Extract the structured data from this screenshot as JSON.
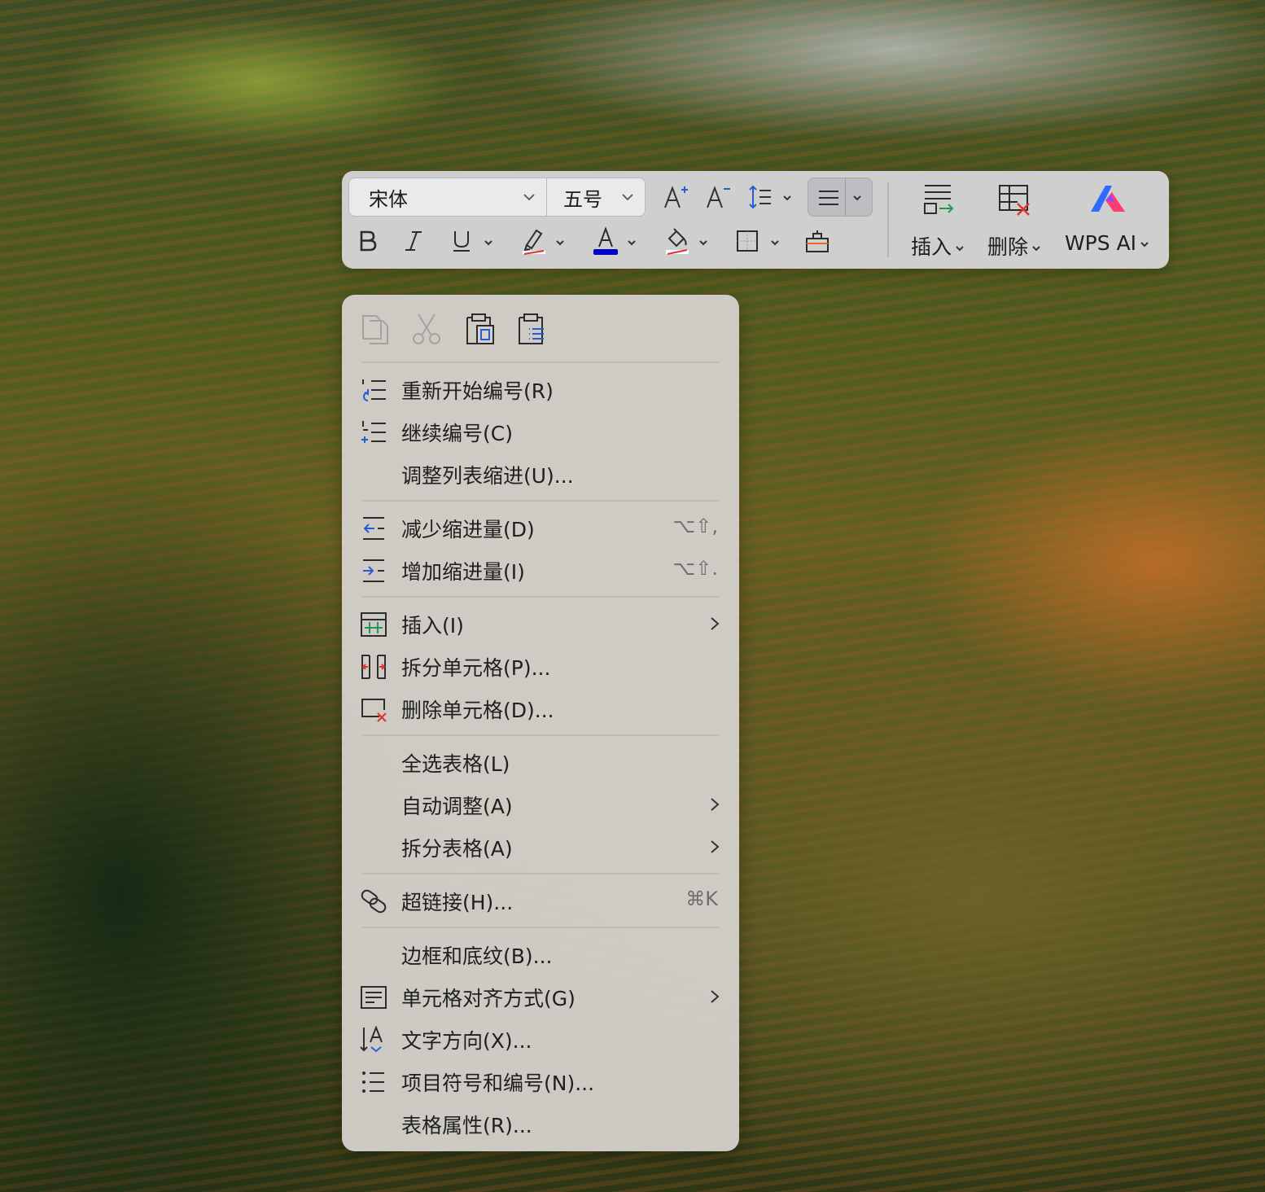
{
  "toolbar": {
    "font_name": "宋体",
    "font_size": "五号",
    "insert_label": "插入",
    "delete_label": "删除",
    "wps_ai_label": "WPS AI",
    "icons": [
      "increase-font-icon",
      "decrease-font-icon",
      "line-spacing-icon",
      "align-icon",
      "bold-icon",
      "italic-icon",
      "underline-icon",
      "highlight-icon",
      "font-color-icon",
      "shading-icon",
      "border-icon",
      "clear-format-icon",
      "insert-icon",
      "delete-table-icon",
      "wps-ai-icon"
    ],
    "font_color": "#0000cc",
    "highlight_color": "#e0332b",
    "wps_ai_colors": [
      "#2f6bff",
      "#ff3d6e"
    ]
  },
  "menu": {
    "clipboard_icons": [
      "copy-icon",
      "cut-icon",
      "paste-icon",
      "paste-special-icon"
    ],
    "items": [
      {
        "label": "重新开始编号(R)",
        "icon": "restart-numbering-icon"
      },
      {
        "label": "继续编号(C)",
        "icon": "continue-numbering-icon"
      },
      {
        "label": "调整列表缩进(U)..."
      },
      {
        "label": "减少缩进量(D)",
        "icon": "decrease-indent-icon",
        "shortcut": "⌥⇧,"
      },
      {
        "label": "增加缩进量(I)",
        "icon": "increase-indent-icon",
        "shortcut": "⌥⇧."
      },
      {
        "label": "插入(I)",
        "icon": "insert-table-icon",
        "submenu": true
      },
      {
        "label": "拆分单元格(P)...",
        "icon": "split-cells-icon"
      },
      {
        "label": "删除单元格(D)...",
        "icon": "delete-cells-icon"
      },
      {
        "label": "全选表格(L)"
      },
      {
        "label": "自动调整(A)",
        "submenu": true
      },
      {
        "label": "拆分表格(A)",
        "submenu": true
      },
      {
        "label": "超链接(H)...",
        "icon": "hyperlink-icon",
        "shortcut": "⌘K"
      },
      {
        "label": "边框和底纹(B)..."
      },
      {
        "label": "单元格对齐方式(G)",
        "icon": "cell-alignment-icon",
        "submenu": true
      },
      {
        "label": "文字方向(X)...",
        "icon": "text-direction-icon"
      },
      {
        "label": "项目符号和编号(N)...",
        "icon": "bullets-numbering-icon"
      },
      {
        "label": "表格属性(R)..."
      }
    ]
  }
}
